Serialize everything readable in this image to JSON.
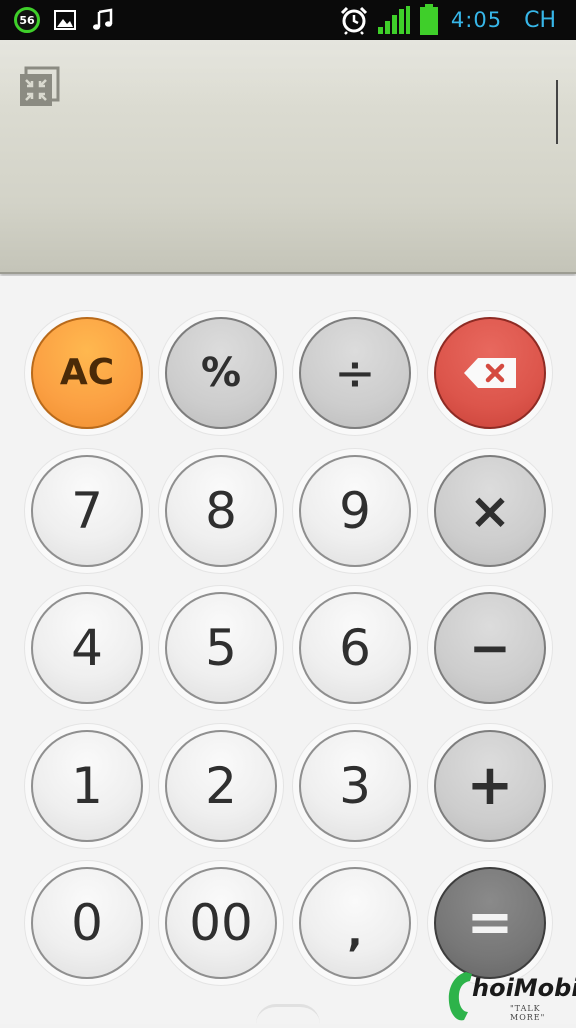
{
  "status_bar": {
    "notification_count": "56",
    "time": "4:05",
    "language": "CH",
    "icons": [
      "notification-badge",
      "gallery-icon",
      "music-note-icon",
      "alarm-clock-icon",
      "signal-bars-icon",
      "battery-icon"
    ],
    "colors": {
      "accent": "#37b6e8",
      "signal": "#3fcf2a"
    }
  },
  "display": {
    "collapse_icon": "collapse-icon",
    "cursor_visible": true
  },
  "keypad": {
    "rows": [
      [
        {
          "id": "ac",
          "label": "AC",
          "kind": "ac"
        },
        {
          "id": "percent",
          "label": "%",
          "kind": "op"
        },
        {
          "id": "divide",
          "label": "÷",
          "kind": "op"
        },
        {
          "id": "delete",
          "label": "",
          "kind": "del",
          "icon": "backspace-icon"
        }
      ],
      [
        {
          "id": "7",
          "label": "7",
          "kind": "num"
        },
        {
          "id": "8",
          "label": "8",
          "kind": "num"
        },
        {
          "id": "9",
          "label": "9",
          "kind": "num"
        },
        {
          "id": "multiply",
          "label": "×",
          "kind": "op"
        }
      ],
      [
        {
          "id": "4",
          "label": "4",
          "kind": "num"
        },
        {
          "id": "5",
          "label": "5",
          "kind": "num"
        },
        {
          "id": "6",
          "label": "6",
          "kind": "num"
        },
        {
          "id": "minus",
          "label": "−",
          "kind": "op"
        }
      ],
      [
        {
          "id": "1",
          "label": "1",
          "kind": "num"
        },
        {
          "id": "2",
          "label": "2",
          "kind": "num"
        },
        {
          "id": "3",
          "label": "3",
          "kind": "num"
        },
        {
          "id": "plus",
          "label": "+",
          "kind": "op"
        }
      ],
      [
        {
          "id": "0",
          "label": "0",
          "kind": "num"
        },
        {
          "id": "00",
          "label": "00",
          "kind": "num"
        },
        {
          "id": "comma",
          "label": ",",
          "kind": "num"
        },
        {
          "id": "equals",
          "label": "=",
          "kind": "eq"
        }
      ]
    ],
    "colors": {
      "ac": "#fba043",
      "delete": "#dc554b",
      "equals": "#777777"
    }
  },
  "watermark": {
    "brand": "hoiMobile",
    "tagline": "\"TALK MORE\""
  }
}
